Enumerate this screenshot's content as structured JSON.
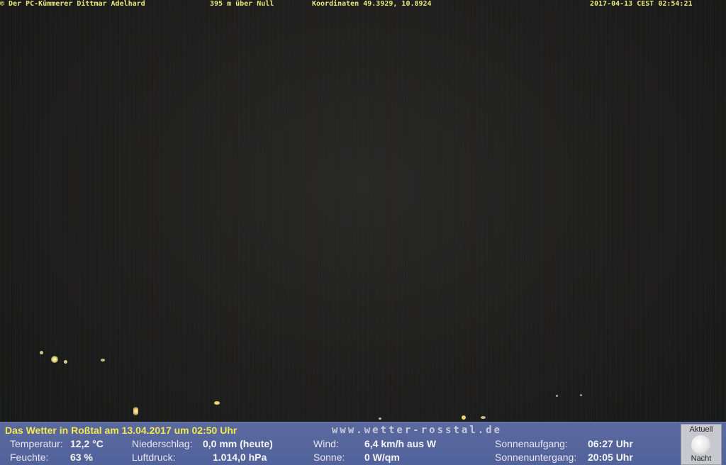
{
  "overlay": {
    "copyright": "© Der PC-Kümmerer Dittmar Adelhard",
    "altitude": "395 m über Null",
    "coordinates": "Koordinaten 49.3929, 10.8924",
    "timestamp": "2017-04-13 CEST 02:54:21"
  },
  "weather": {
    "title": "Das Wetter in Roßtal am 13.04.2017 um 02:50 Uhr",
    "url": "www.wetter-rosstal.de",
    "temperature_label": "Temperatur:",
    "temperature_value": "12,2 °C",
    "humidity_label": "Feuchte:",
    "humidity_value": "63 %",
    "precip_label": "Niederschlag:",
    "precip_value": "0,0 mm (heute)",
    "pressure_label": "Luftdruck:",
    "pressure_value": "1.014,0 hPa",
    "wind_label": "Wind:",
    "wind_value": "6,4 km/h aus W",
    "sun_label": "Sonne:",
    "sun_value": "0 W/qm",
    "sunrise_label": "Sonnenaufgang:",
    "sunrise_value": "06:27 Uhr",
    "sunset_label": "Sonnenuntergang:",
    "sunset_value": "20:05 Uhr"
  },
  "moon": {
    "top_label": "Aktuell",
    "bottom_label": "Nacht",
    "icon": "moon-icon"
  }
}
